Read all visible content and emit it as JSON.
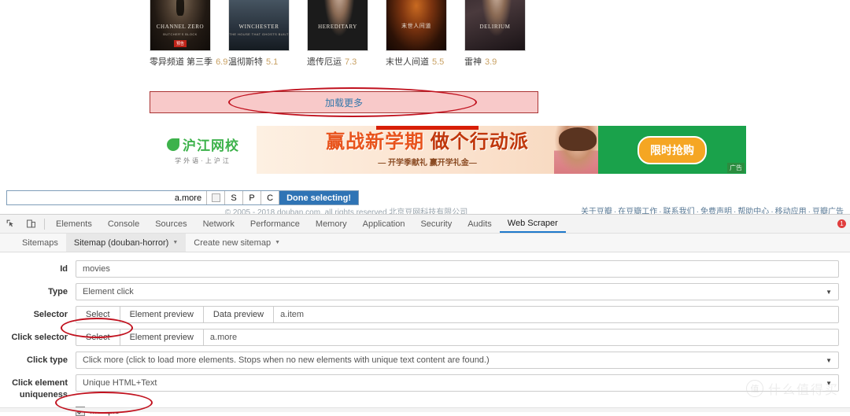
{
  "page": {
    "movies": [
      {
        "title": "零异频道 第三季",
        "rating": "6.9",
        "poster_title": "CHANNEL ZERO",
        "poster_sub": "BUTCHER'S BLOCK",
        "badge": "预告"
      },
      {
        "title": "温彻斯特",
        "rating": "5.1",
        "poster_title": "WINCHESTER",
        "poster_sub": "THE HOUSE THAT GHOSTS BUILT",
        "badge": ""
      },
      {
        "title": "遗传厄运",
        "rating": "7.3",
        "poster_title": "HEREDITARY",
        "poster_sub": "",
        "badge": ""
      },
      {
        "title": "末世人间道",
        "rating": "5.5",
        "poster_title": "末世人间道",
        "poster_sub": "",
        "badge": ""
      },
      {
        "title": "雷神",
        "rating": "3.9",
        "poster_title": "DELIRIUM",
        "poster_sub": "",
        "badge": ""
      }
    ],
    "load_more_label": "加载更多",
    "ad": {
      "brand": "沪江网校",
      "brand_sub": "学外语·上沪江",
      "headline_1": "赢战新学期",
      "headline_2": "做个行动派",
      "subline": "— 开学季献礼 赢开学礼金—",
      "cta": "限时抢购",
      "tag": "广告"
    },
    "copyright": "© 2005 - 2018 douban.com, all rights reserved 北京豆网科技有限公司",
    "footer_links": [
      "关于豆瓣",
      "在豆瓣工作",
      "联系我们",
      "免费声明",
      "帮助中心",
      "移动应用",
      "豆瓣广告"
    ]
  },
  "selector_toolbar": {
    "current_selector": "a.more",
    "button_s": "S",
    "button_p": "P",
    "button_c": "C",
    "done_label": "Done selecting!"
  },
  "devtools": {
    "tabs": [
      {
        "label": "Elements",
        "active": false
      },
      {
        "label": "Console",
        "active": false
      },
      {
        "label": "Sources",
        "active": false
      },
      {
        "label": "Network",
        "active": false
      },
      {
        "label": "Performance",
        "active": false
      },
      {
        "label": "Memory",
        "active": false
      },
      {
        "label": "Application",
        "active": false
      },
      {
        "label": "Security",
        "active": false
      },
      {
        "label": "Audits",
        "active": false
      },
      {
        "label": "Web Scraper",
        "active": true
      }
    ],
    "error_count": "1"
  },
  "webscraper_bar": {
    "sitemaps": "Sitemaps",
    "current_sitemap": "Sitemap (douban-horror)",
    "create_new": "Create new sitemap"
  },
  "form": {
    "id": {
      "label": "Id",
      "value": "movies"
    },
    "type": {
      "label": "Type",
      "value": "Element click"
    },
    "selector": {
      "label": "Selector",
      "select_btn": "Select",
      "element_preview_btn": "Element preview",
      "data_preview_btn": "Data preview",
      "value": "a.item"
    },
    "click_selector": {
      "label": "Click selector",
      "select_btn": "Select",
      "element_preview_btn": "Element preview",
      "value": "a.more"
    },
    "click_type": {
      "label": "Click type",
      "value": "Click more (click to load more elements. Stops when no new elements with unique text content are found.)"
    },
    "click_element_uniqueness": {
      "label_line1": "Click element",
      "label_line2": "uniqueness",
      "value": "Unique HTML+Text"
    },
    "multiple": {
      "label": "Multiple",
      "checked": true
    }
  },
  "watermark": {
    "mark": "值",
    "text": "什么值得买"
  },
  "colors": {
    "accent_blue": "#2f74b5",
    "annotation_red": "#c1121f",
    "devtools_active": "#1f79cb",
    "rating_gold": "#c8a062"
  }
}
